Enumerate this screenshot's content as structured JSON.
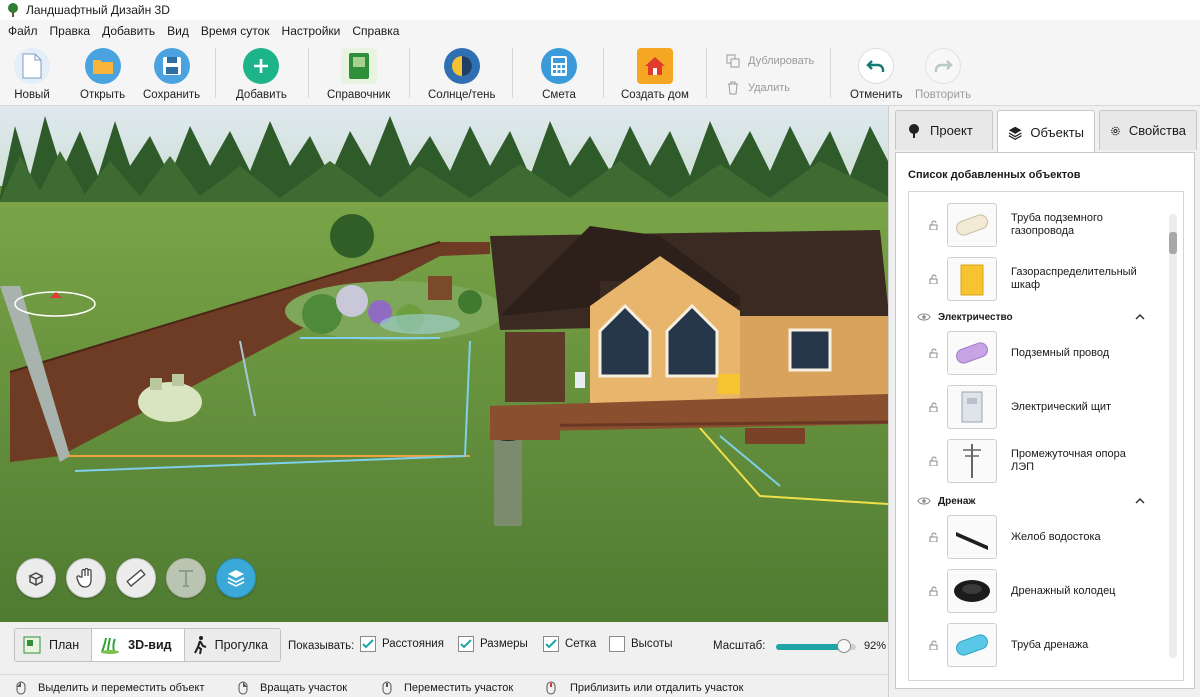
{
  "app": {
    "title": "Ландшафтный Дизайн 3D"
  },
  "menu": [
    "Файл",
    "Правка",
    "Добавить",
    "Вид",
    "Время суток",
    "Настройки",
    "Справка"
  ],
  "toolbar": {
    "new": "Новый",
    "open": "Открыть",
    "save": "Сохранить",
    "add": "Добавить",
    "reference": "Справочник",
    "sun_shadow": "Солнце/тень",
    "estimate": "Смета",
    "create_house": "Создать дом",
    "duplicate": "Дублировать",
    "delete": "Удалить",
    "undo": "Отменить",
    "redo": "Повторить"
  },
  "panel": {
    "tabs": [
      "Проект",
      "Объекты",
      "Свойства"
    ],
    "active_tab": "Объекты",
    "list_title": "Список добавленных объектов",
    "items": [
      {
        "type": "object",
        "name": "Труба подземного газопровода",
        "icon": "pipe-beige"
      },
      {
        "type": "object",
        "name": "Газораспределительный шкаф",
        "icon": "yellow-cabinet"
      },
      {
        "type": "group",
        "name": "Электричество",
        "expanded": true
      },
      {
        "type": "object",
        "name": "Подземный провод",
        "icon": "pipe-purple"
      },
      {
        "type": "object",
        "name": "Электрический щит",
        "icon": "electric-panel"
      },
      {
        "type": "object",
        "name": "Промежуточная опора ЛЭП",
        "icon": "power-pole"
      },
      {
        "type": "group",
        "name": "Дренаж",
        "expanded": true
      },
      {
        "type": "object",
        "name": "Желоб водостока",
        "icon": "gutter"
      },
      {
        "type": "object",
        "name": "Дренажный колодец",
        "icon": "drain-well"
      },
      {
        "type": "object",
        "name": "Труба дренажа",
        "icon": "pipe-blue"
      }
    ]
  },
  "views": {
    "plan": "План",
    "view3d": "3D-вид",
    "walk": "Прогулка",
    "active": "3D-вид"
  },
  "show": {
    "label": "Показывать:",
    "distances": {
      "label": "Расстояния",
      "checked": true
    },
    "sizes": {
      "label": "Размеры",
      "checked": true
    },
    "grid": {
      "label": "Сетка",
      "checked": true
    },
    "heights": {
      "label": "Высоты",
      "checked": false
    }
  },
  "scale": {
    "label": "Масштаб:",
    "value": "92%",
    "percent": 92
  },
  "status": {
    "select_move": "Выделить и переместить объект",
    "rotate": "Вращать участок",
    "pan": "Переместить участок",
    "zoom": "Приблизить или отдалить участок"
  },
  "colors": {
    "accent": "#1fa5a5",
    "active_tool": "#3aa9d8",
    "grass": "#5f8c3a",
    "roof": "#3b2a22",
    "wall": "#e8b56c"
  }
}
